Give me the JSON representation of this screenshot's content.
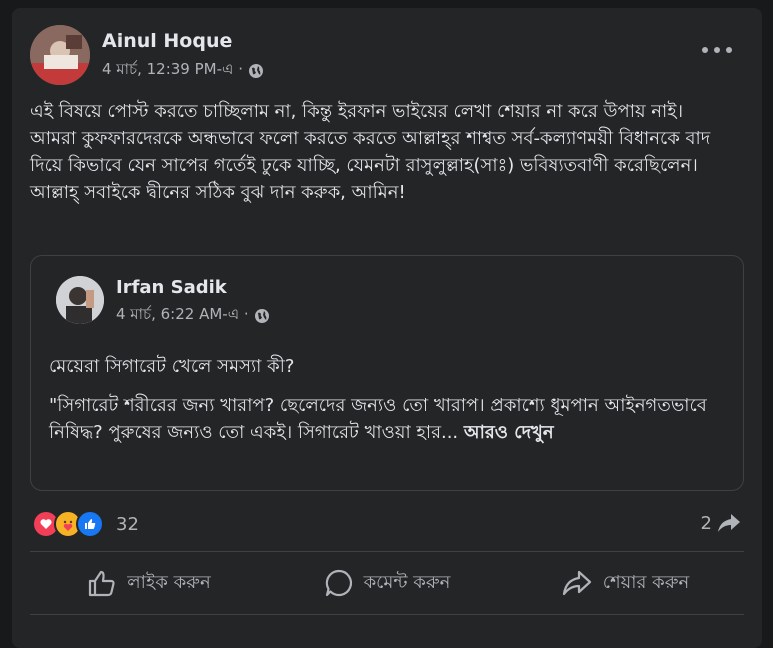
{
  "post": {
    "author": "Ainul Hoque",
    "timestamp": "4 মার্চ, 12:39 PM-এ ·",
    "privacy_icon": "globe-icon",
    "text": "এই বিষয়ে পোস্ট করতে চাচ্ছিলাম না, কিন্তু ইরফান ভাইয়ের লেখা শেয়ার না করে উপায় নাই।\nআমরা কুফফারদেরকে অন্ধভাবে ফলো করতে করতে আল্লাহ্‌র শাশ্বত সর্ব-কল্যাণময়ী বিধানকে বাদ দিয়ে কিভাবে যেন সাপের গর্তেই ঢুকে যাচ্ছি, যেমনটা রাসুলুল্লাহ(সাঃ) ভবিষ্যতবাণী করেছিলেন। আল্লাহ্‌ সবাইকে দ্বীনের সঠিক বুঝ দান করুক, আমিন!"
  },
  "shared": {
    "author": "Irfan Sadik",
    "timestamp": "4 মার্চ, 6:22 AM-এ ·",
    "question": "মেয়েরা সিগারেট খেলে সমস্যা কী?",
    "body": "\"সিগারেট শরীরের জন্য খারাপ? ছেলেদের জন্যও তো খারাপ। প্রকাশ্যে ধূমপান আইনগতভাবে নিষিদ্ধ? পুরুষের জন্যও তো একই। সিগারেট খাওয়া হার... ",
    "see_more": "আরও দেখুন"
  },
  "stats": {
    "reactions": [
      "love-icon",
      "care-icon",
      "like-icon"
    ],
    "reaction_count": "32",
    "share_count": "2"
  },
  "actions": {
    "like": "লাইক করুন",
    "comment": "কমেন্ট করুন",
    "share": "শেয়ার করুন"
  },
  "colors": {
    "background": "#18191a",
    "card": "#242526",
    "text": "#e4e6eb",
    "secondary": "#b0b3b8",
    "like_blue": "#1877f2",
    "love_red": "#f33e58",
    "care_yellow": "#f7b125"
  }
}
